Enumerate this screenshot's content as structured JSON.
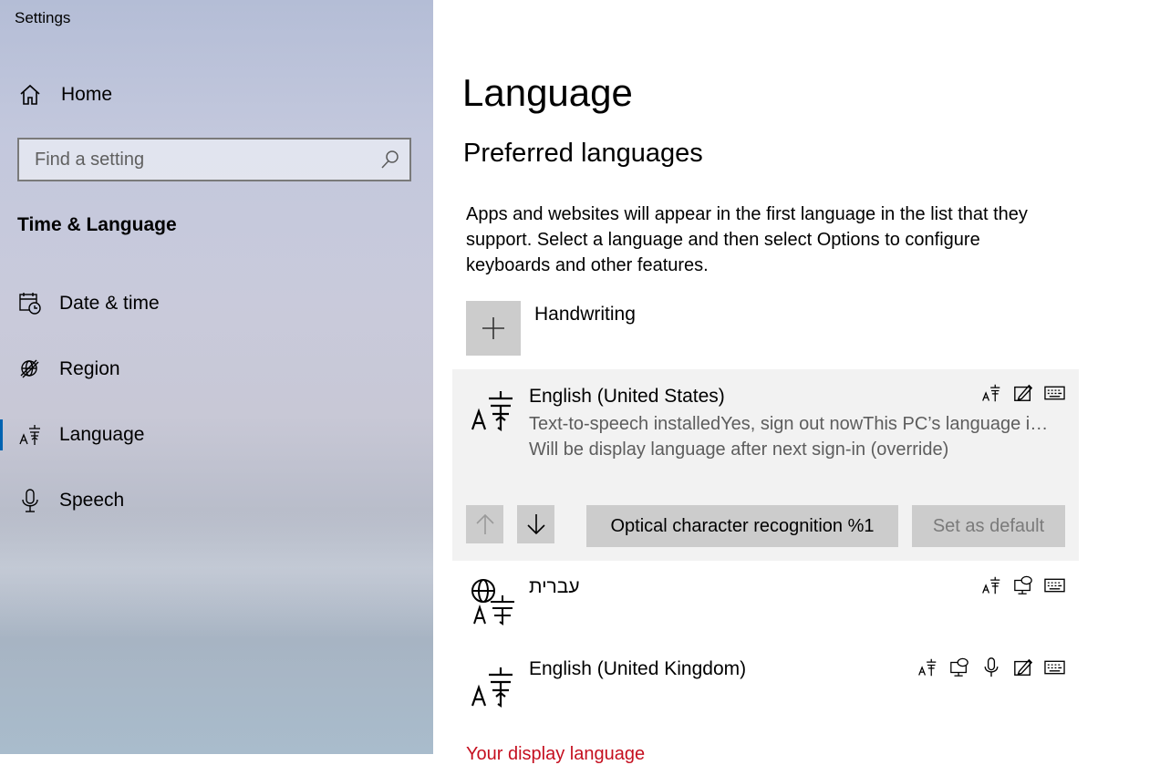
{
  "window": {
    "title": "Settings"
  },
  "sidebar": {
    "home_label": "Home",
    "search_placeholder": "Find a setting",
    "section": "Time & Language",
    "items": [
      {
        "label": "Date & time",
        "icon": "calendar-clock-icon"
      },
      {
        "label": "Region",
        "icon": "globe-icon"
      },
      {
        "label": "Language",
        "icon": "language-icon",
        "active": true
      },
      {
        "label": "Speech",
        "icon": "microphone-icon"
      }
    ],
    "accent_color": "#0063b1"
  },
  "main": {
    "title": "Language",
    "subtitle": "Preferred languages",
    "description": "Apps and websites will appear in the first language in the list that they support. Select a language and then select Options to configure keyboards and other features.",
    "add_label": "Handwriting",
    "languages": [
      {
        "name": "English (United States)",
        "status": "Text-to-speech installedYes, sign out nowThis PC’s language i…",
        "status2": "Will be display language after next sign-in (override)",
        "features": [
          "language-icon",
          "handwriting-icon",
          "keyboard-icon"
        ],
        "buttons": {
          "ocr": "Optical character recognition %1",
          "default": "Set as default"
        }
      },
      {
        "name": "עברית",
        "features": [
          "language-icon",
          "display-speech-icon",
          "keyboard-icon"
        ]
      },
      {
        "name": "English (United Kingdom)",
        "features": [
          "language-icon",
          "display-speech-icon",
          "microphone-icon",
          "handwriting-icon",
          "keyboard-icon"
        ]
      }
    ],
    "footer_link": "Your display language"
  }
}
